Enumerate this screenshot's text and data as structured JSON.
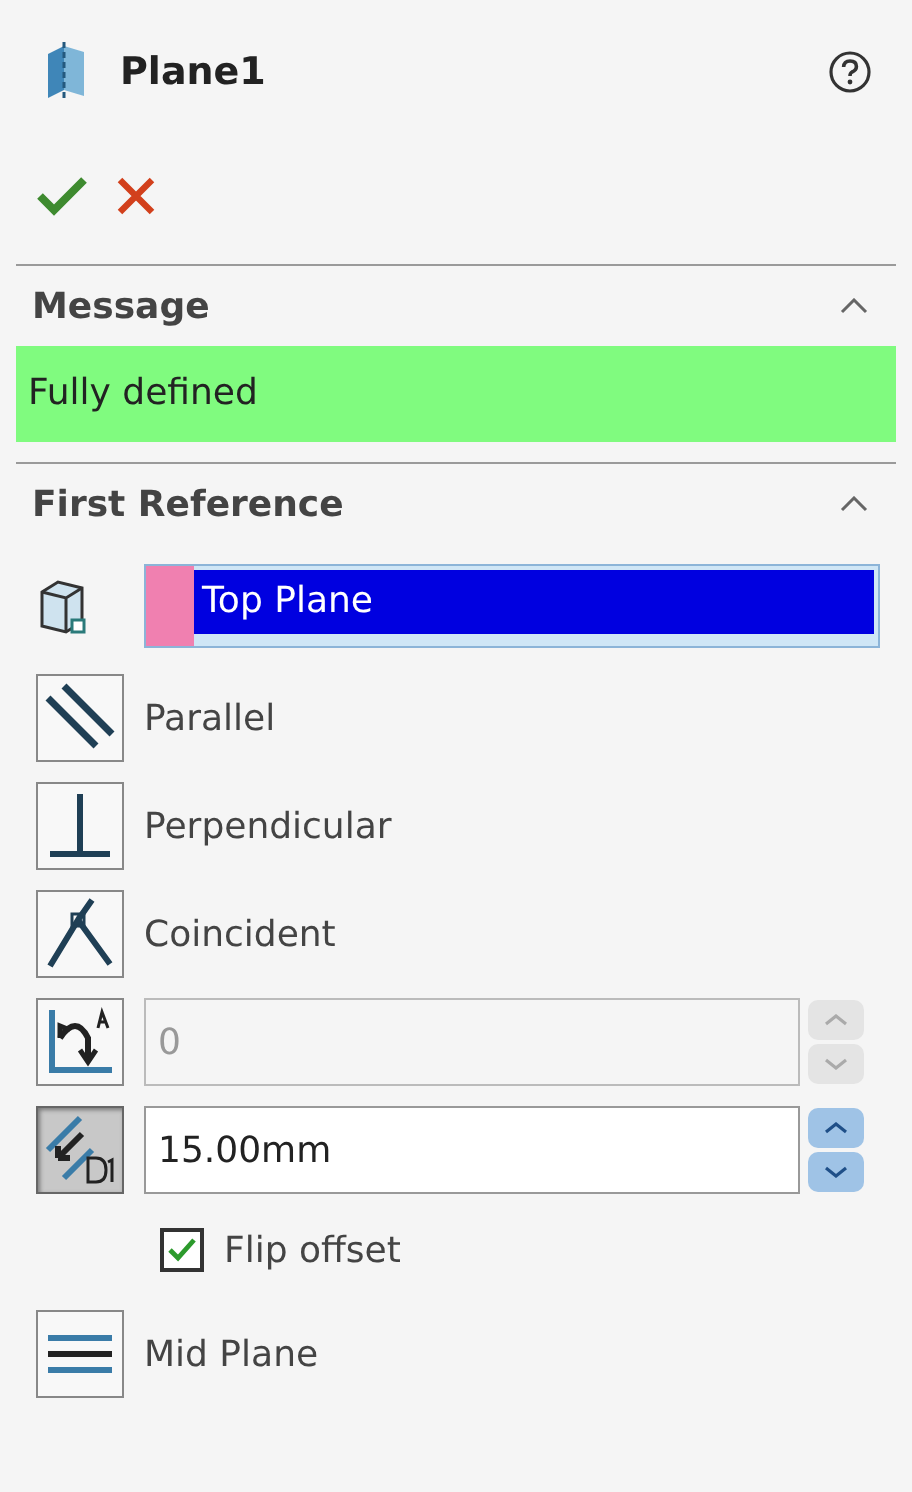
{
  "panel": {
    "title": "Plane1"
  },
  "message": {
    "title": "Message",
    "expanded": true,
    "text": "Fully defined"
  },
  "first_reference": {
    "title": "First Reference",
    "expanded": true,
    "selection": "Top Plane",
    "options": [
      {
        "kind": "parallel",
        "label": "Parallel",
        "selected": false
      },
      {
        "kind": "perpendicular",
        "label": "Perpendicular",
        "selected": false
      },
      {
        "kind": "coincident",
        "label": "Coincident",
        "selected": false
      },
      {
        "kind": "angle",
        "value": "0",
        "selected": false,
        "disabled": true
      },
      {
        "kind": "distance",
        "value": "15.00mm",
        "selected": true,
        "disabled": false
      },
      {
        "kind": "checkbox",
        "label": "Flip offset",
        "checked": true
      },
      {
        "kind": "midplane",
        "label": "Mid Plane",
        "selected": false
      }
    ]
  }
}
